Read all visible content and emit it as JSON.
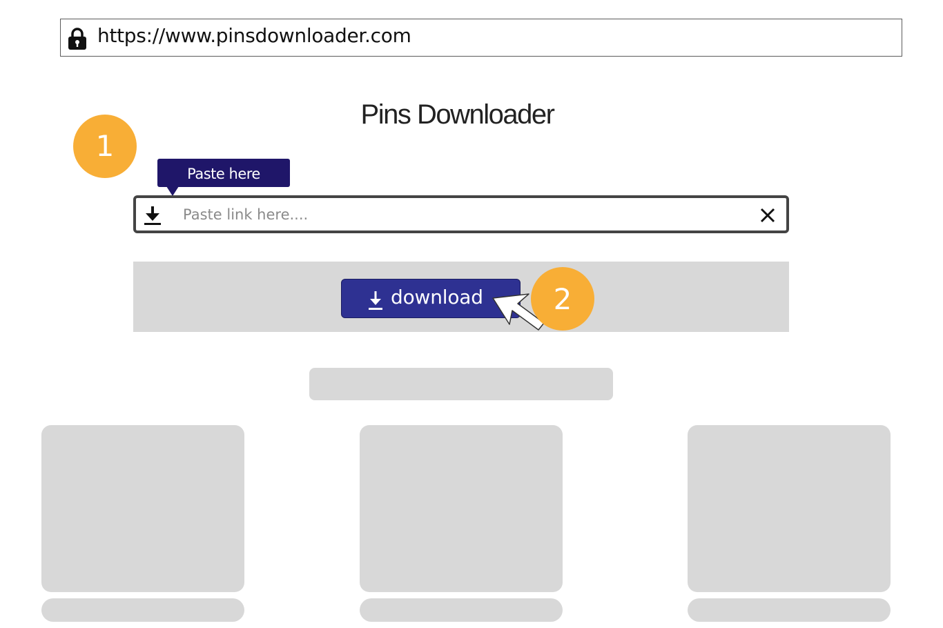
{
  "browser": {
    "url": "https://www.pinsdownloader.com"
  },
  "page": {
    "title": "Pins Downloader"
  },
  "steps": {
    "one": "1",
    "two": "2"
  },
  "tooltip": {
    "text": "Paste here"
  },
  "input": {
    "value": "",
    "placeholder": "Paste link here...."
  },
  "download_button": {
    "label": "download"
  },
  "icons": {
    "lock": "lock-icon",
    "download": "download-arrow-icon",
    "clear": "close-icon",
    "cursor": "mouse-pointer-icon"
  },
  "colors": {
    "accent": "#2e3192",
    "tooltip": "#1f1669",
    "badge": "#f8ae36",
    "skeleton": "#d8d8d8"
  }
}
